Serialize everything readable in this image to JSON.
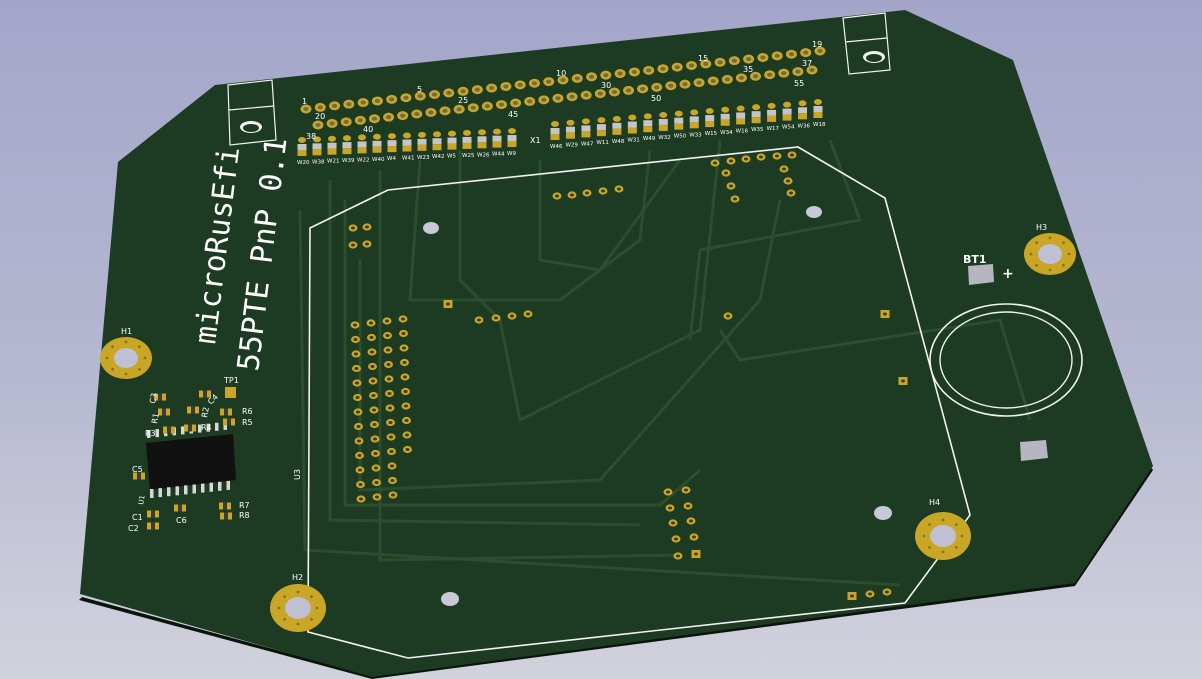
{
  "board": {
    "title": "microRusEfi",
    "subtitle": "55PTE PnP 0.1",
    "colors": {
      "soldermask": "#1d3a22",
      "copper_trace": "#2d5230",
      "pad_gold": "#c9a625",
      "silkscreen": "#ffffff",
      "background": "#aeb1cc"
    }
  },
  "connector": {
    "ref": "X1",
    "top_pin_numbers": [
      "1",
      "5",
      "10",
      "15",
      "19"
    ],
    "top_row_secondary": [
      "20",
      "25",
      "30",
      "35",
      "37"
    ],
    "second_row_numbers": [
      "38",
      "40",
      "45",
      "50",
      "55"
    ]
  },
  "jumpers_left": [
    "W20",
    "W38",
    "W21",
    "W39",
    "W22",
    "W40",
    "W4",
    "W41",
    "W23",
    "W42",
    "W5",
    "W25",
    "W26",
    "W44",
    "W9"
  ],
  "jumpers_right": [
    "W46",
    "W29",
    "W47",
    "W11",
    "W48",
    "W31",
    "W49",
    "W32",
    "W50",
    "W33",
    "W15",
    "W34",
    "W16",
    "W35",
    "W17",
    "W54",
    "W36",
    "W18"
  ],
  "mounting_holes": [
    "H1",
    "H2",
    "H3",
    "H4"
  ],
  "battery": {
    "ref": "BT1",
    "polarity": "+"
  },
  "components": [
    "TP1",
    "C3",
    "C4",
    "R1",
    "R2",
    "R3",
    "R4",
    "R5",
    "R6",
    "C5",
    "U1",
    "C1",
    "C2",
    "C6",
    "R7",
    "R8"
  ],
  "module_ref": "U3"
}
